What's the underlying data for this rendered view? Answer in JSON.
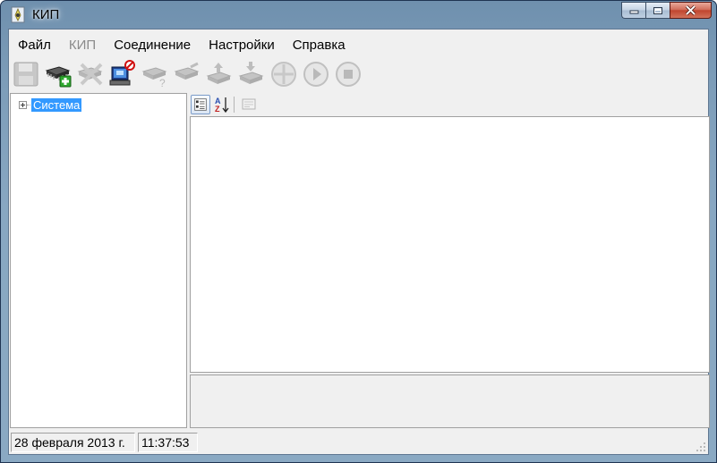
{
  "window": {
    "title": "КИП"
  },
  "menu": [
    "Файл",
    "КИП",
    "Соединение",
    "Настройки",
    "Справка"
  ],
  "menu_disabled": [
    false,
    true,
    false,
    false,
    false
  ],
  "toolbar": {
    "buttons": [
      "save-icon",
      "add-device-icon",
      "remove-device-icon",
      "disconnect-icon",
      "device-query-icon",
      "device-settings-icon",
      "upload-icon",
      "download-icon",
      "sync-icon",
      "play-icon",
      "stop-icon"
    ]
  },
  "tree": {
    "root_label": "Система"
  },
  "status": {
    "date": "28 февраля 2013 г.",
    "time": "11:37:53"
  }
}
